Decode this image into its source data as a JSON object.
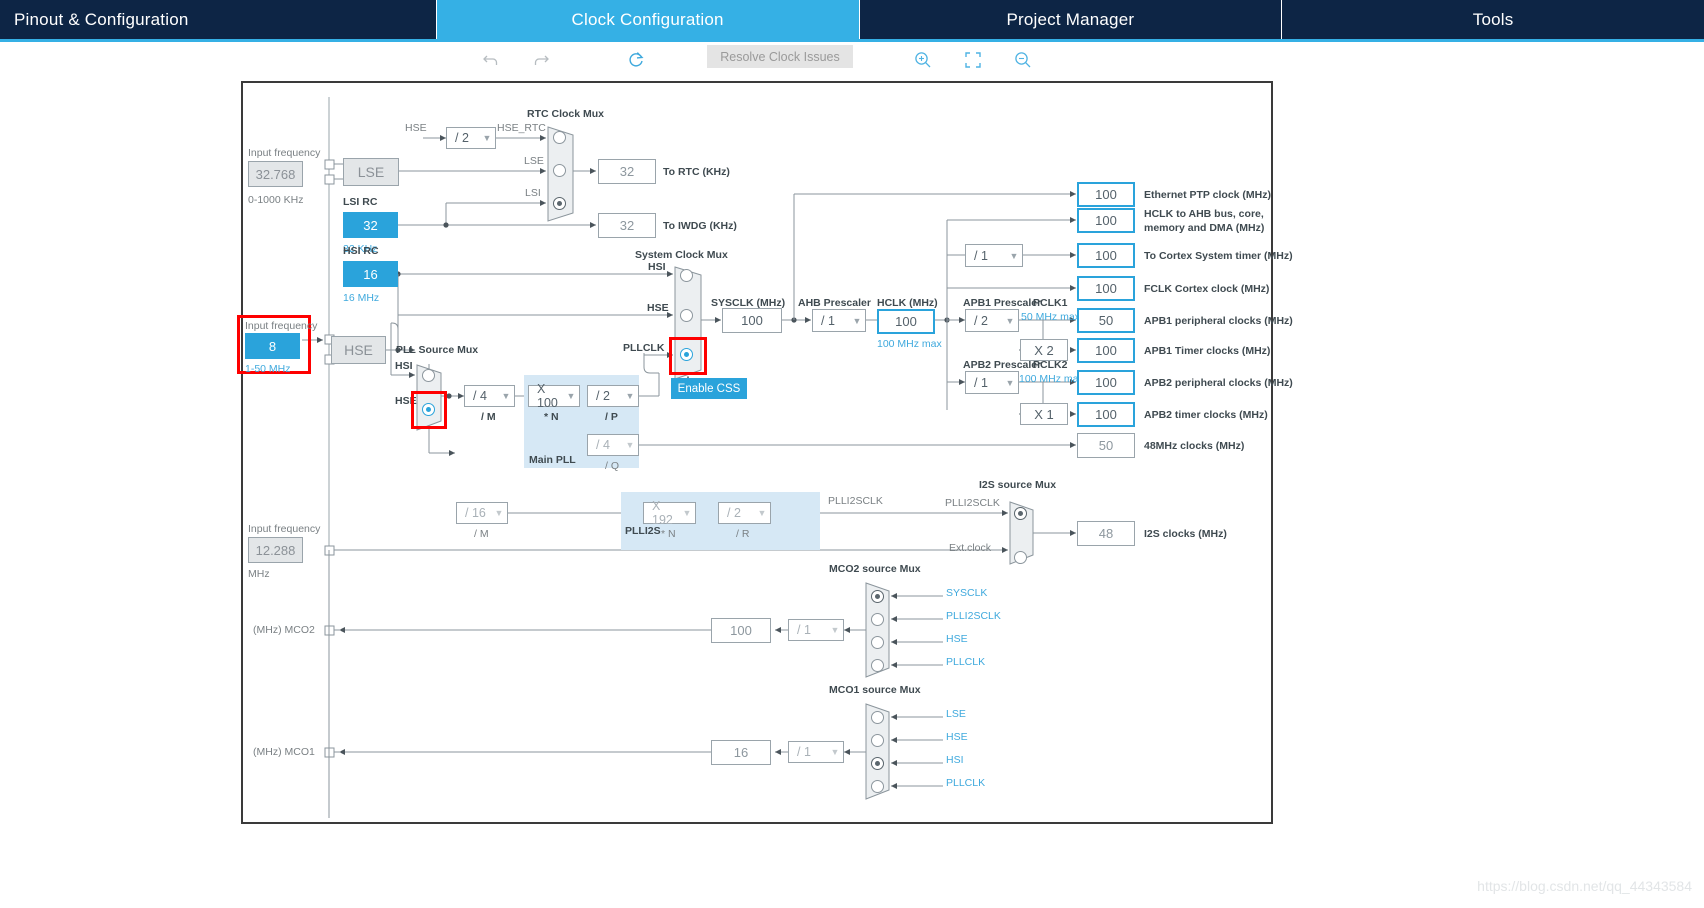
{
  "tabs": [
    {
      "label": "Pinout & Configuration",
      "active": false
    },
    {
      "label": "Clock Configuration",
      "active": true
    },
    {
      "label": "Project Manager",
      "active": false
    },
    {
      "label": "Tools",
      "active": false
    }
  ],
  "toolbar": {
    "undo_icon": "undo-icon",
    "redo_icon": "redo-icon",
    "refresh_icon": "refresh-icon",
    "resolve_label": "Resolve Clock Issues",
    "zoom_in_icon": "zoom-in-icon",
    "fit_icon": "fit-to-screen-icon",
    "zoom_out_icon": "zoom-out-icon"
  },
  "diagram": {
    "lse": {
      "input_freq_label": "Input frequency",
      "value": "32.768",
      "range": "0-1000 KHz",
      "osc_label": "LSE"
    },
    "hse": {
      "input_freq_label": "Input frequency",
      "value": "8",
      "range": "1-50 MHz",
      "osc_label": "HSE"
    },
    "i2s_in": {
      "input_freq_label": "Input frequency",
      "value": "12.288",
      "unit": "MHz"
    },
    "lsi_rc": {
      "title": "LSI RC",
      "value": "32",
      "sub": "32 KHz"
    },
    "hsi_rc": {
      "title": "HSI RC",
      "value": "16",
      "sub": "16 MHz"
    },
    "hse_rtc_div": {
      "value": "/ 2"
    },
    "hse_in_label": "HSE",
    "hse_rtc_label": "HSE_RTC",
    "rtc_mux": {
      "title": "RTC Clock Mux",
      "inputs": [
        "HSE_RTC",
        "LSE",
        "LSI"
      ],
      "selected": 2
    },
    "to_rtc": {
      "value": "32",
      "label": "To RTC (KHz)"
    },
    "to_iwdg": {
      "value": "32",
      "label": "To IWDG (KHz)"
    },
    "pll_source_mux": {
      "title": "PLL Source Mux",
      "inputs": [
        "HSI",
        "HSE"
      ],
      "selected": 1
    },
    "main_pll": {
      "title": "Main PLL",
      "m": {
        "value": "/ 4",
        "sub": "/ M"
      },
      "n": {
        "value": "X 100",
        "sub": "* N"
      },
      "p": {
        "value": "/ 2",
        "sub": "/ P"
      },
      "q": {
        "value": "/ 4",
        "sub": "/ Q"
      }
    },
    "plli2s": {
      "title": "PLLI2S",
      "m": {
        "value": "/ 16",
        "sub": "/ M"
      },
      "n": {
        "value": "X 192",
        "sub": "* N"
      },
      "r": {
        "value": "/ 2",
        "sub": "/ R"
      }
    },
    "system_clock_mux": {
      "title": "System Clock Mux",
      "inputs": [
        "HSI",
        "HSE",
        "PLLCLK"
      ],
      "selected": 2
    },
    "enable_css": "Enable CSS",
    "sysclk": {
      "label": "SYSCLK (MHz)",
      "value": "100"
    },
    "ahb_prescaler": {
      "label": "AHB Prescaler",
      "value": "/ 1"
    },
    "hclk": {
      "label": "HCLK (MHz)",
      "value": "100",
      "max": "100 MHz max"
    },
    "cortex_prescaler": {
      "value": "/ 1"
    },
    "apb1_prescaler": {
      "label": "APB1 Prescaler",
      "value": "/ 2"
    },
    "apb2_prescaler": {
      "label": "APB2 Prescaler",
      "value": "/ 1"
    },
    "pclk1": {
      "label": "PCLK1",
      "max": "50 MHz max"
    },
    "pclk2": {
      "label": "PCLK2",
      "max": "100 MHz max"
    },
    "apb1_timer_mult": "X 2",
    "apb2_timer_mult": "X 1",
    "outputs": [
      {
        "value": "100",
        "label": "Ethernet PTP clock (MHz)",
        "style": "outblue"
      },
      {
        "value": "100",
        "label": "HCLK to AHB bus, core,\nmemory and DMA (MHz)",
        "style": "outblue"
      },
      {
        "value": "100",
        "label": "To Cortex  System timer (MHz)",
        "style": "outblue"
      },
      {
        "value": "100",
        "label": "FCLK Cortex clock (MHz)",
        "style": "outblue"
      },
      {
        "value": "50",
        "label": "APB1 peripheral clocks (MHz)",
        "style": "outblue"
      },
      {
        "value": "100",
        "label": "APB1 Timer clocks (MHz)",
        "style": "outblue"
      },
      {
        "value": "100",
        "label": "APB2 peripheral clocks (MHz)",
        "style": "outblue"
      },
      {
        "value": "100",
        "label": "APB2 timer clocks (MHz)",
        "style": "outblue"
      }
    ],
    "clk48": {
      "value": "50",
      "label": "48MHz clocks (MHz)"
    },
    "i2s_source_mux": {
      "title": "I2S source Mux",
      "inputs": [
        "PLLI2SCLK",
        "Ext.clock"
      ],
      "selected": 0
    },
    "plli2sclk_label": "PLLI2SCLK",
    "i2s_out": {
      "value": "48",
      "label": "I2S clocks (MHz)"
    },
    "mco2": {
      "title": "MCO2 source Mux",
      "pin_label": "(MHz) MCO2",
      "value": "100",
      "div": "/ 1",
      "inputs": [
        "SYSCLK",
        "PLLI2SCLK",
        "HSE",
        "PLLCLK"
      ],
      "selected": 0
    },
    "mco1": {
      "title": "MCO1 source Mux",
      "pin_label": "(MHz) MCO1",
      "value": "16",
      "div": "/ 1",
      "inputs": [
        "LSE",
        "HSE",
        "HSI",
        "PLLCLK"
      ],
      "selected": 2
    }
  },
  "watermark": "https://blog.csdn.net/qq_44343584",
  "colors": {
    "brand": "#35b0e5",
    "navy": "#0d2545",
    "cyan_fill": "#2aa3db",
    "highlight": "#fe0000"
  }
}
